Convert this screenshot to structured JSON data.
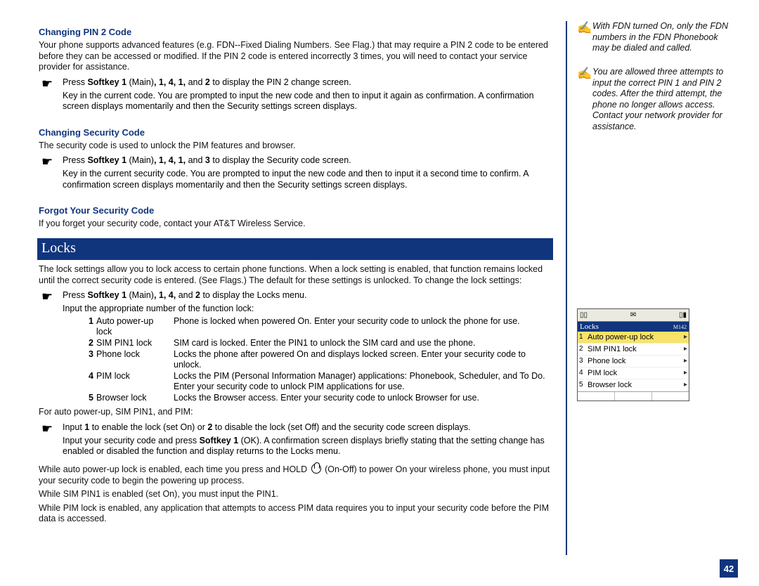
{
  "page_number": "42",
  "headings": {
    "pin2": "Changing  PIN 2 Code",
    "seccode": "Changing Security Code",
    "forgot": "Forgot Your Security Code",
    "locks_bar": "Locks"
  },
  "pin2": {
    "intro": "Your phone supports advanced features (e.g. FDN--Fixed Dialing Numbers. See Flag.) that may require a PIN 2 code to be entered before they can be accessed or modified. If the PIN 2 code is entered incorrectly 3 times, you will need to contact your service provider for assistance.",
    "step1_pre": "Press ",
    "sk1": "Softkey 1",
    "step1_mid": " (Main)",
    "seq": ", 1, 4, 1,",
    "step1_and": " and ",
    "step1_num": "2",
    "step1_post": " to display the PIN 2 change screen.",
    "step2": "Key in the current code. You are prompted to input the new code and then to input it again as confirmation. A confirmation screen displays momentarily and then the Security settings screen displays."
  },
  "seccode": {
    "intro": "The security code is used to unlock the PIM features and browser.",
    "step1_pre": "Press ",
    "sk1": "Softkey 1",
    "step1_mid": " (Main)",
    "seq": ", 1, 4, 1,",
    "step1_and": " and ",
    "step1_num": "3",
    "step1_post": " to display the Security code screen.",
    "step2": "Key in the current security code. You are prompted to input the new code and then to input it a second time to confirm. A confirmation screen displays momentarily and then the Security settings screen displays."
  },
  "forgot": {
    "text": "If you forget your security code, contact your AT&T Wireless Service."
  },
  "locks": {
    "intro": "The lock settings allow you to lock access to certain phone functions. When a lock setting is enabled, that function remains locked until the correct security code is entered. (See Flags.) The default for these settings is unlocked. To change the lock settings:",
    "step1_pre": "Press ",
    "sk1": "Softkey 1",
    "step1_mid": " (Main)",
    "seq": ", 1, 4,",
    "step1_and": " and ",
    "step1_num": "2",
    "step1_post": " to display the Locks menu.",
    "step1b": "Input the appropriate number of the function lock:",
    "table": [
      {
        "num": "1",
        "name": "Auto power-up lock",
        "desc": "Phone is locked when powered On. Enter your security code to unlock the phone for use."
      },
      {
        "num": "2",
        "name": "SIM PIN1 lock",
        "desc": "SIM card is locked. Enter the PIN1 to unlock the SIM card and use the phone."
      },
      {
        "num": "3",
        "name": "Phone lock",
        "desc": "Locks the phone after powered On and displays locked screen. Enter your security code to unlock."
      },
      {
        "num": "4",
        "name": "PIM lock",
        "desc": "Locks the PIM (Personal Information Manager) applications: Phonebook, Scheduler, and To Do. Enter your security code to unlock PIM applications for use."
      },
      {
        "num": "5",
        "name": "Browser lock",
        "desc": "Locks the Browser access. Enter your security code to unlock Browser for use."
      }
    ],
    "pre_auto": "For auto power-up, SIM PIN1, and PIM:",
    "step2a_pre": "Input ",
    "step2a_1": "1",
    "step2a_mid": " to enable the lock (set On) or ",
    "step2a_2": "2",
    "step2a_post": " to disable the lock (set Off) and the security code screen displays.",
    "step2b_pre": "Input your security code and press ",
    "step2b_sk": "Softkey 1",
    "step2b_post": " (OK). A confirmation screen displays briefly stating that the setting change has enabled or disabled the function and display returns to the Locks menu.",
    "p_auto_a": "While auto power-up lock is enabled, each time you press and HOLD ",
    "p_auto_b": " (On-Off) to power On your wireless phone, you must input your security code to begin the powering up process.",
    "p_sim": "While SIM PIN1 is enabled (set On), you must input the PIN1.",
    "p_pim": "While PIM lock is enabled, any application that attempts to access PIM data requires you to input your security code before the PIM data is accessed."
  },
  "sidebar": {
    "note1": "With FDN turned On, only the FDN numbers in the FDN Phonebook may be dialed and called.",
    "note2": "You are allowed three attempts to input the correct PIN 1 and PIN 2 codes. After the third attempt, the phone no longer allows access. Contact your network provider for assistance.",
    "phone": {
      "title": "Locks",
      "tag": "M142",
      "items": [
        {
          "num": "1",
          "label": "Auto power-up lock",
          "sel": true
        },
        {
          "num": "2",
          "label": "SIM PIN1 lock",
          "sel": false
        },
        {
          "num": "3",
          "label": "Phone lock",
          "sel": false
        },
        {
          "num": "4",
          "label": "PIM lock",
          "sel": false
        },
        {
          "num": "5",
          "label": "Browser lock",
          "sel": false
        }
      ]
    }
  }
}
